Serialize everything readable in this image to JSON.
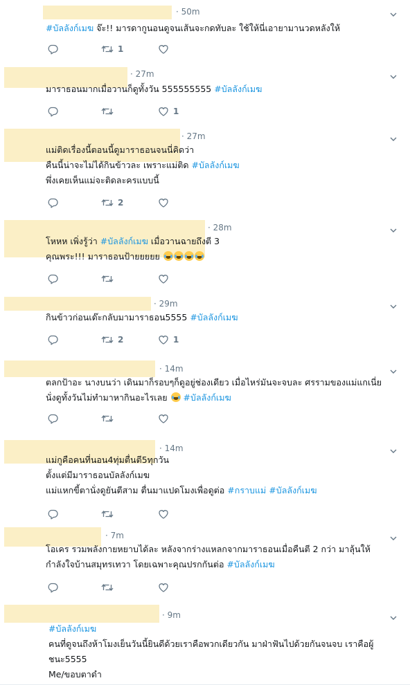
{
  "tweets": [
    {
      "time": "50m",
      "lines": [
        [
          "#บัลลังก์เมฆ",
          " จ๊ะ!! มารดากูนอนดูจนเส้นจะกดทับละ ใช้ให้นี่เอายามานวดหลังให้"
        ]
      ],
      "reply": "",
      "retweet": "1",
      "like": ""
    },
    {
      "time": "27m",
      "lines": [
        [
          "มาราธอนมากเมื่อวานก็ดูทั้งวัน 555555555 ",
          "#บัลลังก์เมฆ"
        ]
      ],
      "reply": "",
      "retweet": "",
      "like": "1"
    },
    {
      "time": "27m",
      "lines": [
        [
          "แม่ติดเรื่องนี้ตอนนี้ดูมาราธอนจนนี่คิดว่า"
        ],
        [
          "คืนนี้น่าจะไม่ได้กินข้าวละ เพราะแม่ติด ",
          "#บัลลังก์เมฆ"
        ],
        [
          "พึ่งเคยเห็นแม่จะติดละครแบบนี้"
        ]
      ],
      "reply": "",
      "retweet": "2",
      "like": ""
    },
    {
      "time": "28m",
      "lines": [
        [
          "โหหห เพิ่งรู้ว่า ",
          "#บัลลังก์เมฆ",
          " เมื่อวานฉายถึงตี 3"
        ],
        [
          "คุณพระ!!!  มาราธอนป้ายยยยย  "
        ]
      ],
      "emoji_count": 4,
      "reply": "",
      "retweet": "",
      "like": ""
    },
    {
      "time": "29m",
      "lines": [
        [
          "กินข้าวก่อนเด๊ะกลับมามาราธอน5555  ",
          "#บัลลังก์เมฆ"
        ]
      ],
      "reply": "",
      "retweet": "2",
      "like": "1"
    },
    {
      "time": "14m",
      "lines": [
        [
          "ตลกป้าอะ นางบนว่า เดินมาก็รอบๆก็ดูอยู่ช่องเดียว เมื่อไหร่มันจะจบละ ศรรามของแม่แกเนี่ย"
        ],
        [
          "นั่งดูทั้งวันไม่ทำมาหากินอะไรเลย  ",
          " ",
          "#บัลลังก์เมฆ"
        ]
      ],
      "emoji_line": 1,
      "reply": "",
      "retweet": "",
      "like": ""
    },
    {
      "time": "14m",
      "lines": [
        [
          "แม่กูคือคนที่นอน4ทุ่มตื่นตี5ทุกวัน"
        ],
        [
          "ตั้งแต่มีมาราธอนบัลลังก์เมฆ"
        ],
        [
          "แม่แหกขี้ตานั่งดูยันตีสาม ตื่นมาแปดโมงเพื่อดูต่อ ",
          "#กราบแม่",
          " ",
          "#บัลลังก์เมฆ"
        ]
      ],
      "reply": "",
      "retweet": "",
      "like": ""
    },
    {
      "time": "7m",
      "lines": [
        [
          "โอเคร รวมพลังกายหยาบได้ละ หลังจากร่างแหลกจากมาราธอนเมื่อคืนตี 2 กว่า มาลุ้นให้"
        ],
        [
          "กำลังใจบ้านสมุทรเทวา โดยเฉพาะคุณปรกกันต่อ ",
          "#บัลลังก์เมฆ"
        ]
      ],
      "reply": "",
      "retweet": "",
      "like": ""
    },
    {
      "time": "9m",
      "lines": [
        [
          "#บัลลังก์เมฆ"
        ],
        [
          "คนที่ดูจนถึงห้าโมงเย็นวันนี้ยินดีด้วยเราคือพวกเดียวกัน มาฝ่าฟันไปด้วยกันจนจบ เราคือผู้"
        ],
        [
          "ชนะ5555"
        ],
        [
          "Me/ขอบตาดำ"
        ]
      ],
      "reply": "",
      "retweet": "",
      "like": ""
    }
  ]
}
